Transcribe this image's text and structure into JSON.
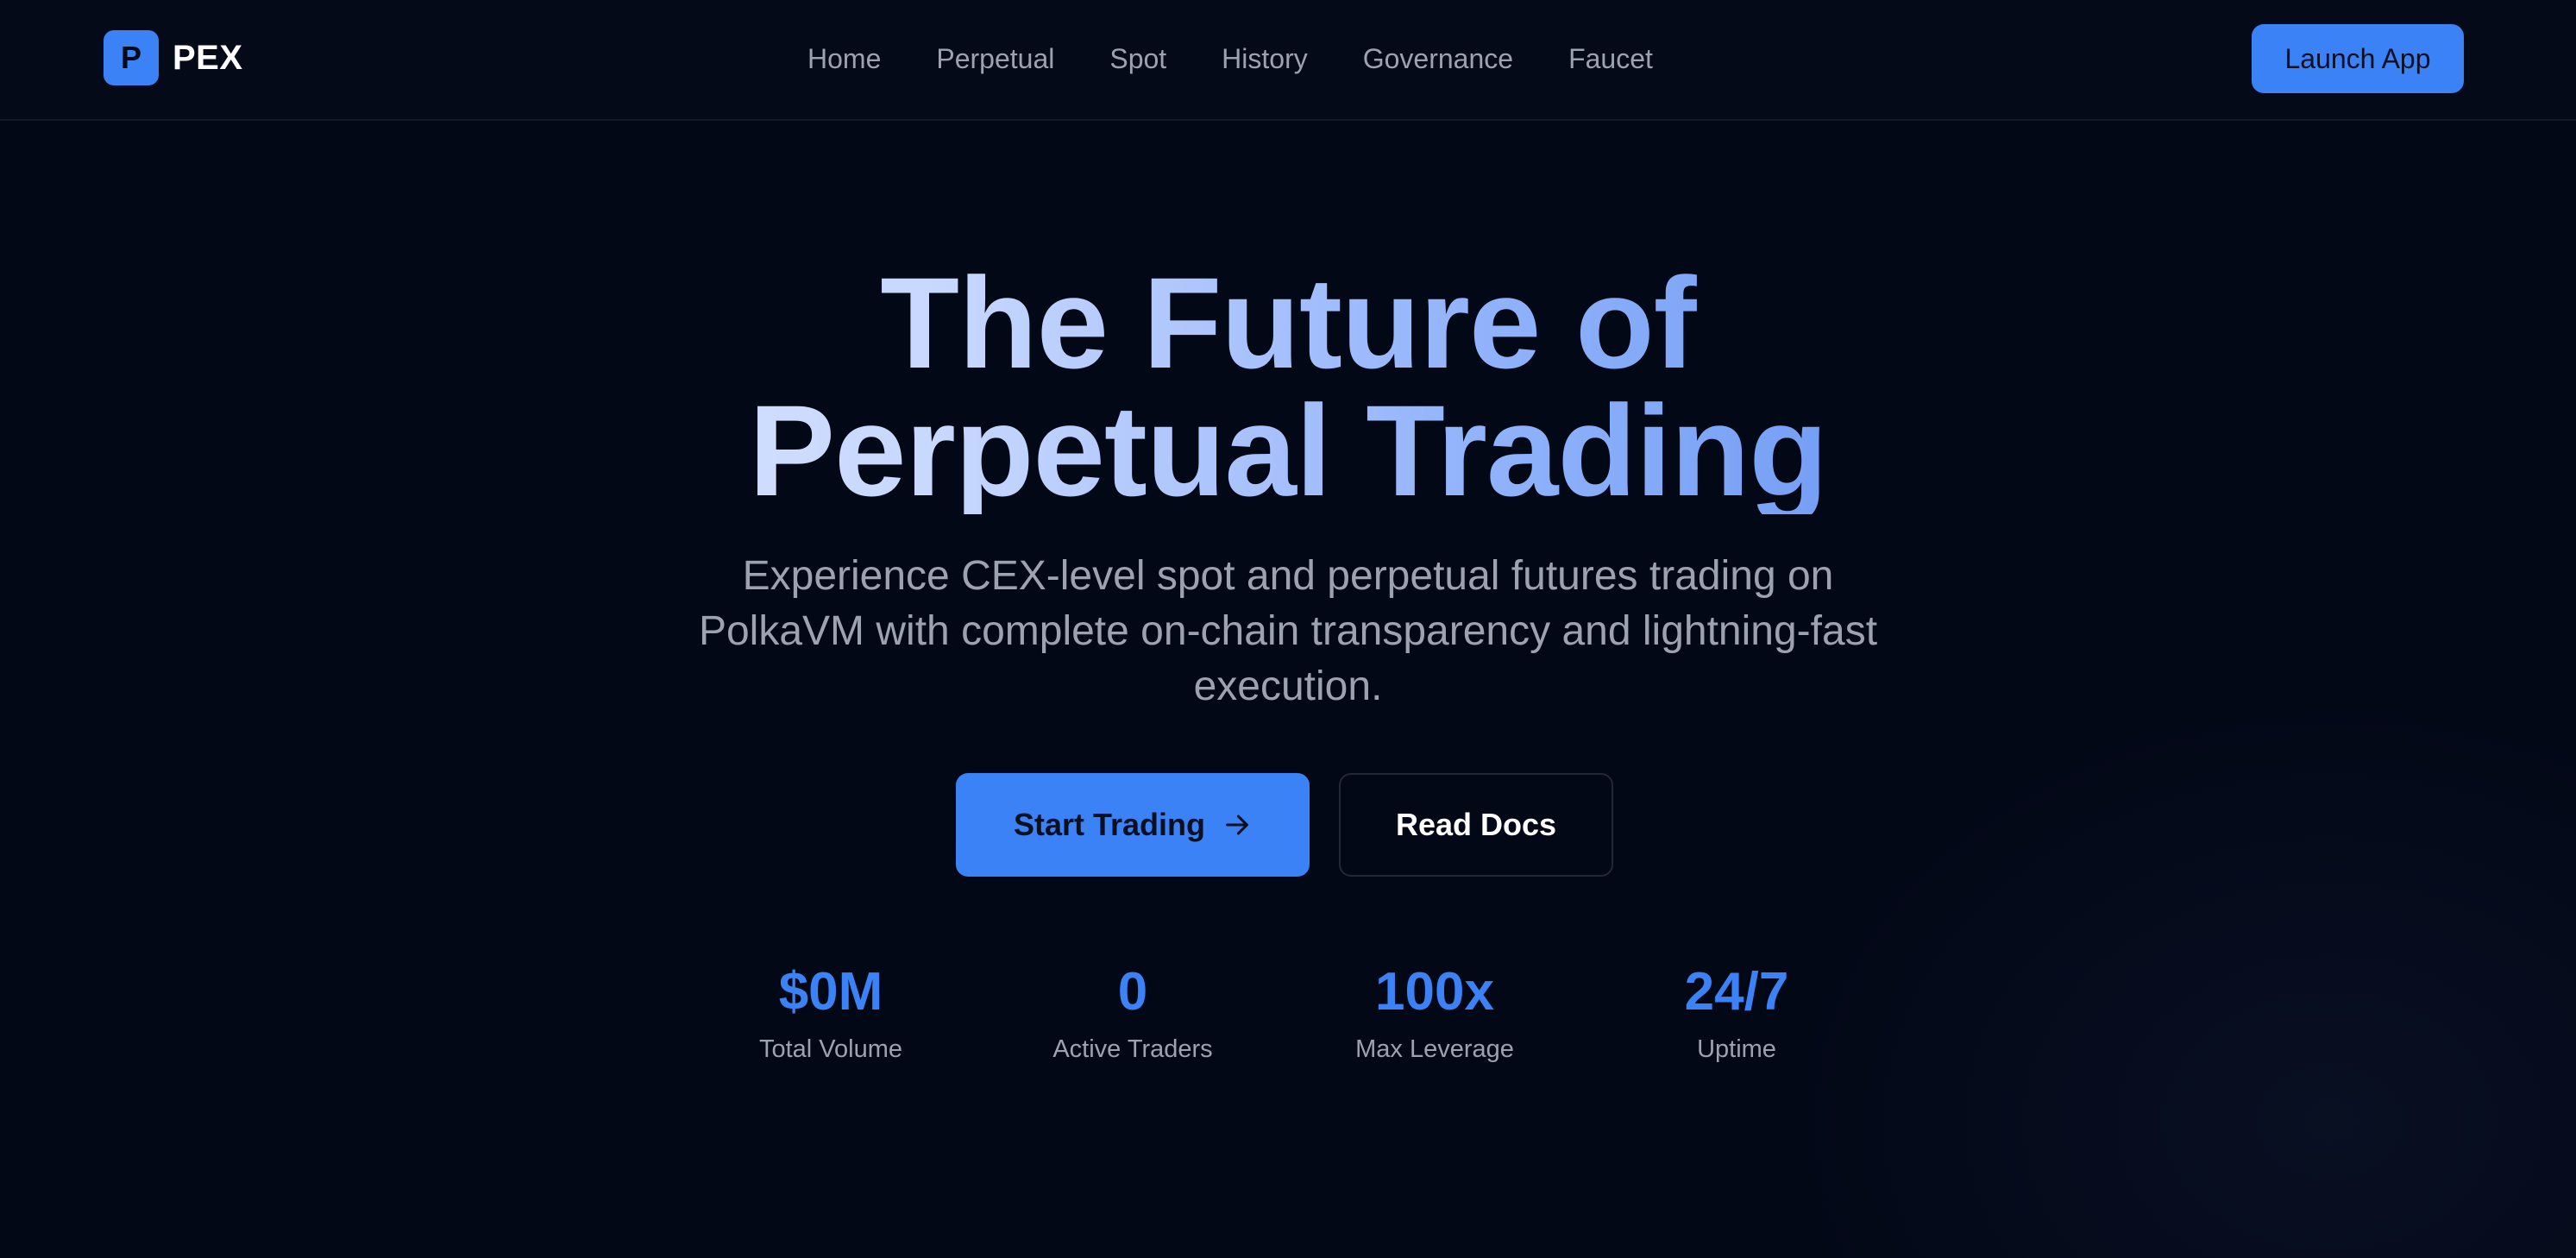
{
  "brand": {
    "mark": "P",
    "name": "PEX"
  },
  "nav": {
    "items": [
      {
        "label": "Home"
      },
      {
        "label": "Perpetual"
      },
      {
        "label": "Spot"
      },
      {
        "label": "History"
      },
      {
        "label": "Governance"
      },
      {
        "label": "Faucet"
      }
    ]
  },
  "header": {
    "launch_label": "Launch App"
  },
  "hero": {
    "title_line1": "The Future of",
    "title_line2": "Perpetual Trading",
    "subtitle": "Experience CEX-level spot and perpetual futures trading on PolkaVM with complete on-chain transparency and lightning-fast execution.",
    "primary_cta": "Start Trading",
    "primary_cta_icon": "arrow-right-icon",
    "secondary_cta": "Read Docs"
  },
  "stats": [
    {
      "value": "$0M",
      "label": "Total Volume"
    },
    {
      "value": "0",
      "label": "Active Traders"
    },
    {
      "value": "100x",
      "label": "Max Leverage"
    },
    {
      "value": "24/7",
      "label": "Uptime"
    }
  ],
  "colors": {
    "background": "#030817",
    "accent": "#3b82f6",
    "muted_text": "#9ca3af",
    "gradient_start": "#dbe6ff",
    "gradient_end": "#5b8def"
  }
}
